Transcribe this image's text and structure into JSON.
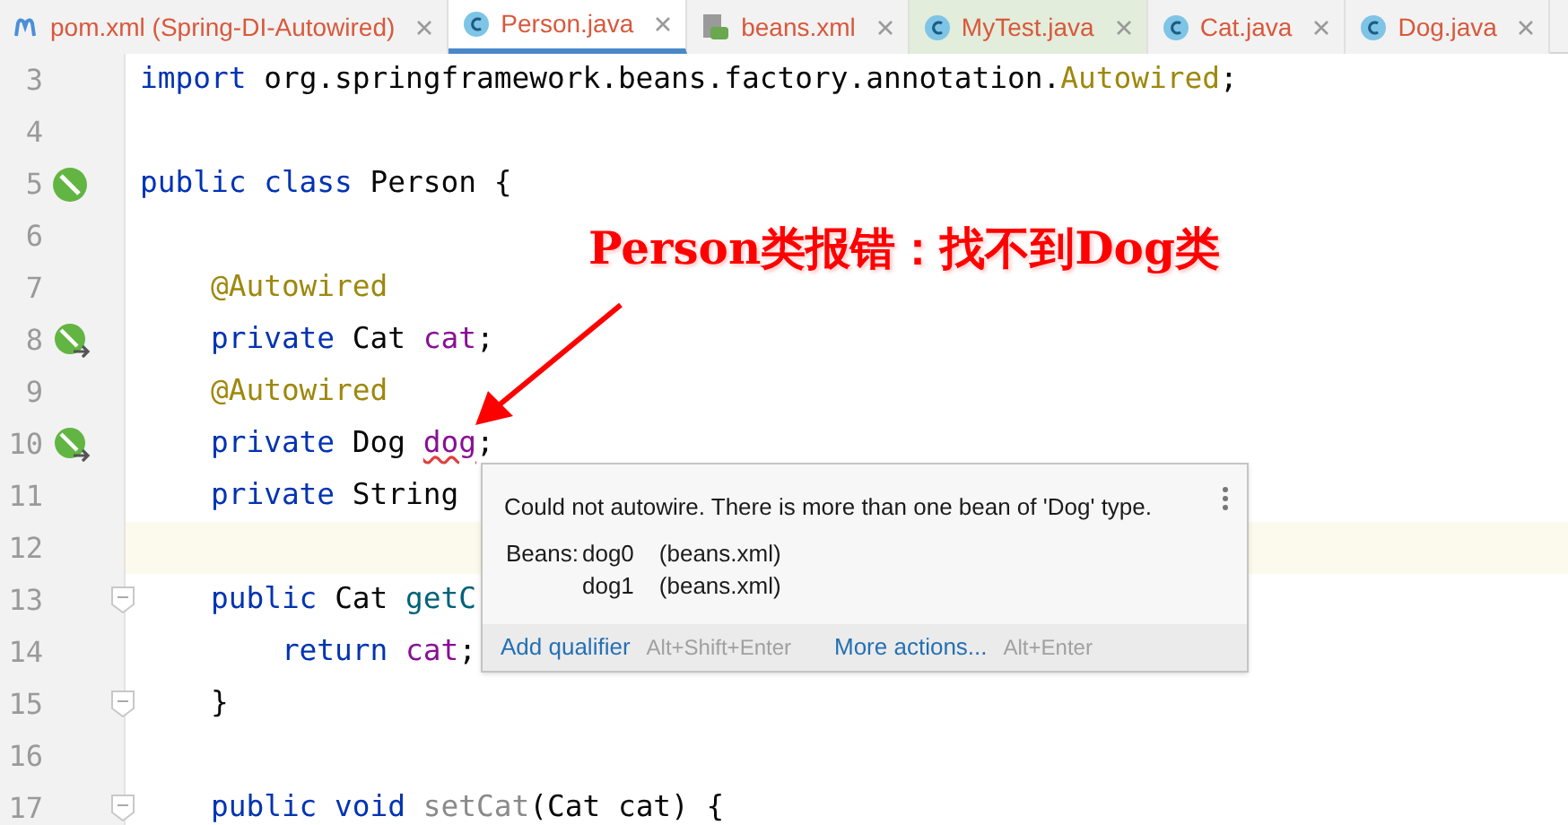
{
  "tabs": [
    {
      "label": "pom.xml (Spring-DI-Autowired)",
      "kind": "maven",
      "selected": false
    },
    {
      "label": "Person.java",
      "kind": "class",
      "selected": true
    },
    {
      "label": "beans.xml",
      "kind": "xml",
      "selected": false
    },
    {
      "label": "MyTest.java",
      "kind": "class",
      "selected": false,
      "test": true
    },
    {
      "label": "Cat.java",
      "kind": "class",
      "selected": false
    },
    {
      "label": "Dog.java",
      "kind": "class",
      "selected": false
    }
  ],
  "editor": {
    "lines": [
      {
        "number": "3",
        "tokens": [
          {
            "kind": "keyword",
            "text": "import "
          },
          {
            "kind": "plain",
            "text": "org.springframework.beans.factory.annotation."
          },
          {
            "kind": "annotation",
            "text": "Autowired"
          },
          {
            "kind": "plain",
            "text": ";"
          }
        ]
      },
      {
        "number": "4"
      },
      {
        "number": "5",
        "marker": {
          "kind": "bean"
        },
        "tokens": [
          {
            "kind": "keyword",
            "text": "public class "
          },
          {
            "kind": "plain",
            "text": "Person {"
          }
        ]
      },
      {
        "number": "6"
      },
      {
        "number": "7",
        "tokens": [
          {
            "kind": "annotation",
            "text": "    @Autowired"
          }
        ]
      },
      {
        "number": "8",
        "marker": {
          "kind": "inject"
        },
        "tokens": [
          {
            "kind": "keyword",
            "text": "    private "
          },
          {
            "kind": "plain",
            "text": "Cat "
          },
          {
            "kind": "field",
            "text": "cat"
          },
          {
            "kind": "plain",
            "text": ";"
          }
        ]
      },
      {
        "number": "9",
        "tokens": [
          {
            "kind": "annotation",
            "text": "    @Autowired"
          }
        ]
      },
      {
        "number": "10",
        "marker": {
          "kind": "inject"
        },
        "tokens": [
          {
            "kind": "keyword",
            "text": "    private "
          },
          {
            "kind": "plain",
            "text": "Dog "
          },
          {
            "kind": "error",
            "text": "dog"
          },
          {
            "kind": "plain",
            "text": ";"
          }
        ]
      },
      {
        "number": "11",
        "tokens": [
          {
            "kind": "keyword",
            "text": "    private "
          },
          {
            "kind": "plain",
            "text": "String"
          }
        ]
      },
      {
        "number": "12",
        "current": true
      },
      {
        "number": "13",
        "fold": true,
        "tokens": [
          {
            "kind": "keyword",
            "text": "    public "
          },
          {
            "kind": "plain",
            "text": "Cat "
          },
          {
            "kind": "method",
            "text": "getC"
          }
        ]
      },
      {
        "number": "14",
        "tokens": [
          {
            "kind": "keyword",
            "text": "        return "
          },
          {
            "kind": "field",
            "text": "cat"
          },
          {
            "kind": "plain",
            "text": ";"
          }
        ]
      },
      {
        "number": "15",
        "fold": true,
        "tokens": [
          {
            "kind": "plain",
            "text": "    }"
          }
        ]
      },
      {
        "number": "16"
      },
      {
        "number": "17",
        "fold": true,
        "tokens": [
          {
            "kind": "keyword",
            "text": "    public void "
          },
          {
            "kind": "unused",
            "text": "setCat"
          },
          {
            "kind": "plain",
            "text": "(Cat cat) {"
          }
        ]
      }
    ]
  },
  "callout": {
    "text": "Person类报错：找不到Dog类"
  },
  "popup": {
    "message": "Could not autowire. There is more than one bean of 'Dog' type.",
    "beans_label": "Beans:",
    "beans": [
      {
        "name": "dog0",
        "source": "(beans.xml)"
      },
      {
        "name": "dog1",
        "source": "(beans.xml)"
      }
    ],
    "actions": [
      {
        "label": "Add qualifier",
        "shortcut": "Alt+Shift+Enter"
      },
      {
        "label": "More actions...",
        "shortcut": "Alt+Enter"
      }
    ]
  }
}
